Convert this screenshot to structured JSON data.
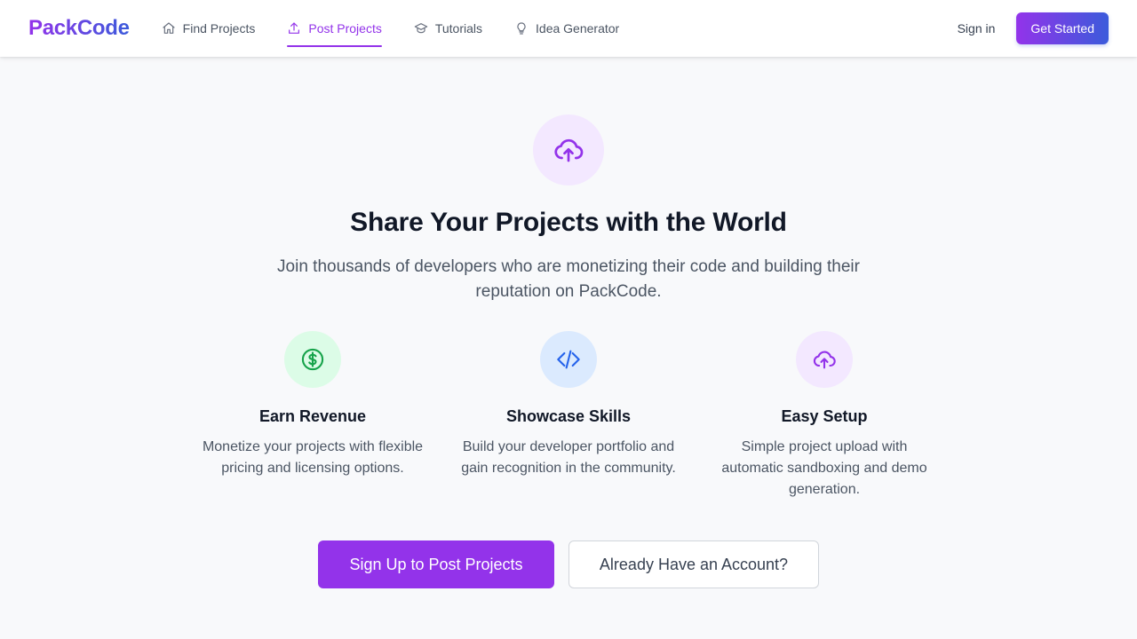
{
  "header": {
    "logo": "PackCode",
    "nav": [
      {
        "label": "Find Projects",
        "icon": "home-icon",
        "active": false
      },
      {
        "label": "Post Projects",
        "icon": "upload-icon",
        "active": true
      },
      {
        "label": "Tutorials",
        "icon": "graduation-cap-icon",
        "active": false
      },
      {
        "label": "Idea Generator",
        "icon": "lightbulb-icon",
        "active": false
      }
    ],
    "signin_label": "Sign in",
    "get_started_label": "Get Started"
  },
  "hero": {
    "icon": "cloud-upload-icon",
    "title": "Share Your Projects with the World",
    "subtitle": "Join thousands of developers who are monetizing their code and building their reputation on PackCode."
  },
  "features": [
    {
      "icon": "dollar-circle-icon",
      "title": "Earn Revenue",
      "description": "Monetize your projects with flexible pricing and licensing options.",
      "icon_bg": "#dcfce7",
      "icon_color": "#16a34a"
    },
    {
      "icon": "code-icon",
      "title": "Showcase Skills",
      "description": "Build your developer portfolio and gain recognition in the community.",
      "icon_bg": "#dbeafe",
      "icon_color": "#2563eb"
    },
    {
      "icon": "cloud-upload-icon",
      "title": "Easy Setup",
      "description": "Simple project upload with automatic sandboxing and demo generation.",
      "icon_bg": "#f3e8ff",
      "icon_color": "#9333ea"
    }
  ],
  "actions": {
    "primary_label": "Sign Up to Post Projects",
    "secondary_label": "Already Have an Account?"
  },
  "colors": {
    "accent": "#9333ea",
    "gradient_end": "#3b5bdb",
    "background": "#f8f9fb"
  }
}
